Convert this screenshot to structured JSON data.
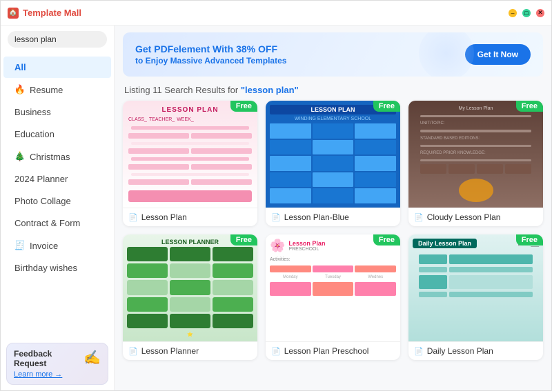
{
  "app": {
    "title": "Template Mall"
  },
  "titlebar": {
    "min": "–",
    "max": "□",
    "close": "✕"
  },
  "search": {
    "value": "lesson plan",
    "placeholder": "lesson plan"
  },
  "sidebar": {
    "items": [
      {
        "id": "all",
        "label": "All",
        "icon": "",
        "active": true
      },
      {
        "id": "resume",
        "label": "Resume",
        "icon": "🔥",
        "active": false
      },
      {
        "id": "business",
        "label": "Business",
        "icon": "",
        "active": false
      },
      {
        "id": "education",
        "label": "Education",
        "icon": "",
        "active": false
      },
      {
        "id": "christmas",
        "label": "Christmas",
        "icon": "🎄",
        "active": false
      },
      {
        "id": "planner",
        "label": "2024 Planner",
        "icon": "",
        "active": false
      },
      {
        "id": "collage",
        "label": "Photo Collage",
        "icon": "",
        "active": false
      },
      {
        "id": "contract",
        "label": "Contract & Form",
        "icon": "",
        "active": false
      },
      {
        "id": "invoice",
        "label": "Invoice",
        "icon": "🧾",
        "active": false
      },
      {
        "id": "birthday",
        "label": "Birthday wishes",
        "icon": "",
        "active": false
      }
    ]
  },
  "banner": {
    "line1": "Get PDFelement With 38% OFF",
    "line2_pre": "to Enjoy Massive ",
    "line2_highlight": "Advanced Templates",
    "btn_label": "Get It Now"
  },
  "results": {
    "header_pre": "Listing 11 Search Results for ",
    "query": "\"lesson plan\""
  },
  "templates": [
    {
      "id": 1,
      "name": "Lesson Plan",
      "badge": "Free",
      "icon": "P"
    },
    {
      "id": 2,
      "name": "Lesson Plan-Blue",
      "badge": "Free",
      "icon": "P"
    },
    {
      "id": 3,
      "name": "Cloudy Lesson Plan",
      "badge": "Free",
      "icon": "P"
    },
    {
      "id": 4,
      "name": "Lesson Planner",
      "badge": "Free",
      "icon": "P"
    },
    {
      "id": 5,
      "name": "Lesson Plan Preschool",
      "badge": "Free",
      "icon": "P"
    },
    {
      "id": 6,
      "name": "Daily Lesson Plan",
      "badge": "Free",
      "icon": "P"
    }
  ],
  "feedback": {
    "title": "Feedback Request",
    "link": "Learn more →",
    "icon": "✍"
  },
  "colors": {
    "accent": "#1a73e8",
    "green_badge": "#22c55e"
  }
}
